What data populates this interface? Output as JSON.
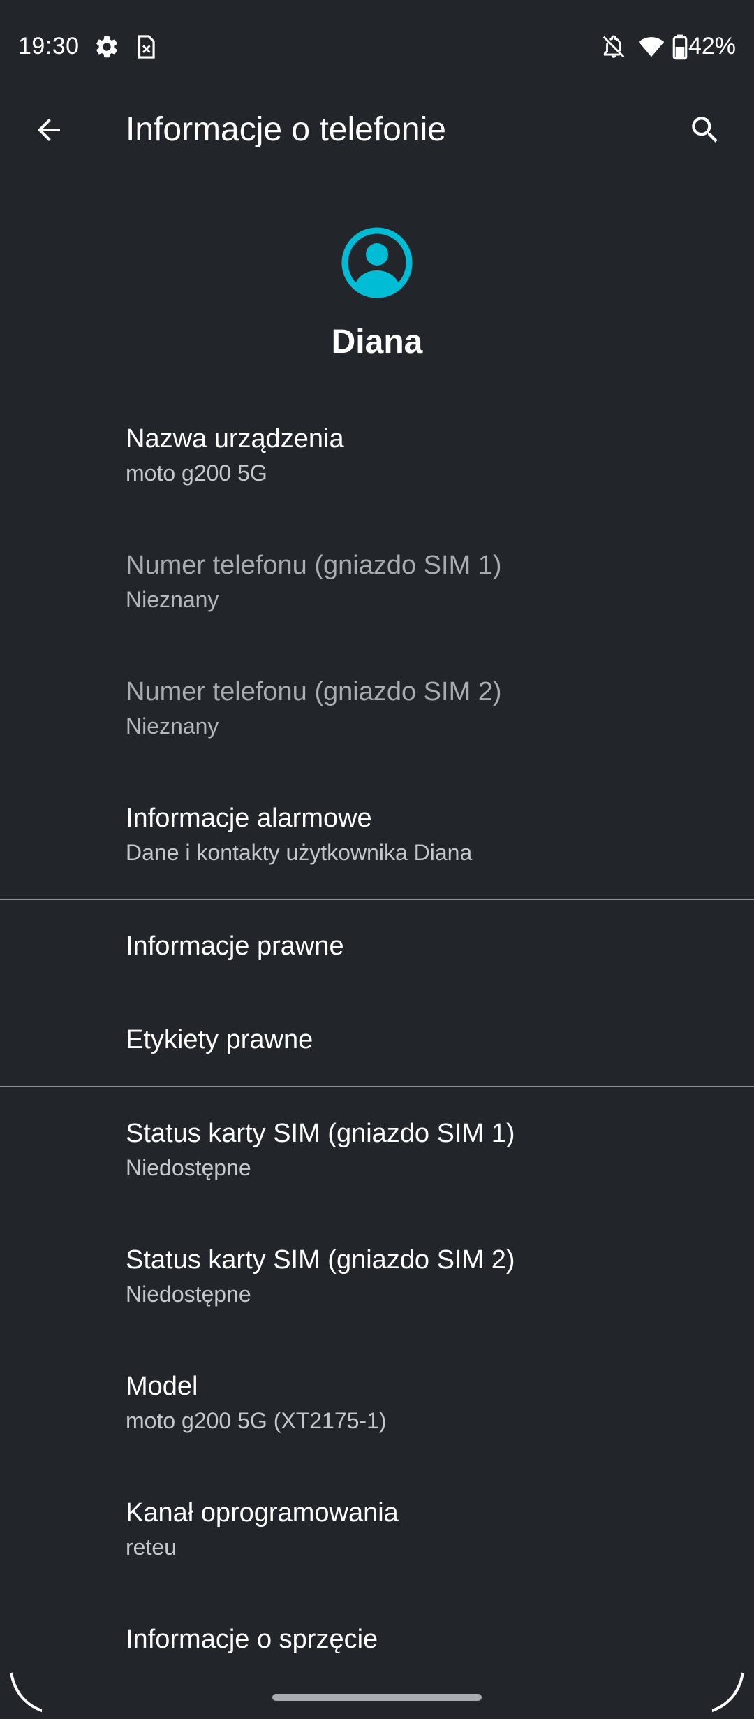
{
  "status_bar": {
    "time": "19:30",
    "battery": "42%",
    "icons": [
      "settings-gear-icon",
      "sim-card-icon",
      "notifications-off-icon",
      "wifi-icon",
      "battery-icon"
    ]
  },
  "app_bar": {
    "title": "Informacje o telefonie",
    "back_icon": "arrow-back-icon",
    "search_icon": "search-icon"
  },
  "profile": {
    "avatar_icon": "account-circle-icon",
    "name": "Diana",
    "accent_color": "#00bcd4"
  },
  "items": [
    {
      "title": "Nazwa urządzenia",
      "summary": "moto g200 5G",
      "enabled": true
    },
    {
      "title": "Numer telefonu (gniazdo SIM 1)",
      "summary": "Nieznany",
      "enabled": false
    },
    {
      "title": "Numer telefonu (gniazdo SIM 2)",
      "summary": "Nieznany",
      "enabled": false
    },
    {
      "title": "Informacje alarmowe",
      "summary": "Dane i kontakty użytkownika Diana",
      "enabled": true
    },
    {
      "title": "Informacje prawne",
      "enabled": true
    },
    {
      "title": "Etykiety prawne",
      "enabled": true
    },
    {
      "title": "Status karty SIM (gniazdo SIM 1)",
      "summary": "Niedostępne",
      "enabled": true
    },
    {
      "title": "Status karty SIM (gniazdo SIM 2)",
      "summary": "Niedostępne",
      "enabled": true
    },
    {
      "title": "Model",
      "summary": "moto g200 5G (XT2175-1)",
      "enabled": true
    },
    {
      "title": "Kanał oprogramowania",
      "summary": "reteu",
      "enabled": true
    },
    {
      "title": "Informacje o sprzęcie",
      "enabled": true
    }
  ]
}
